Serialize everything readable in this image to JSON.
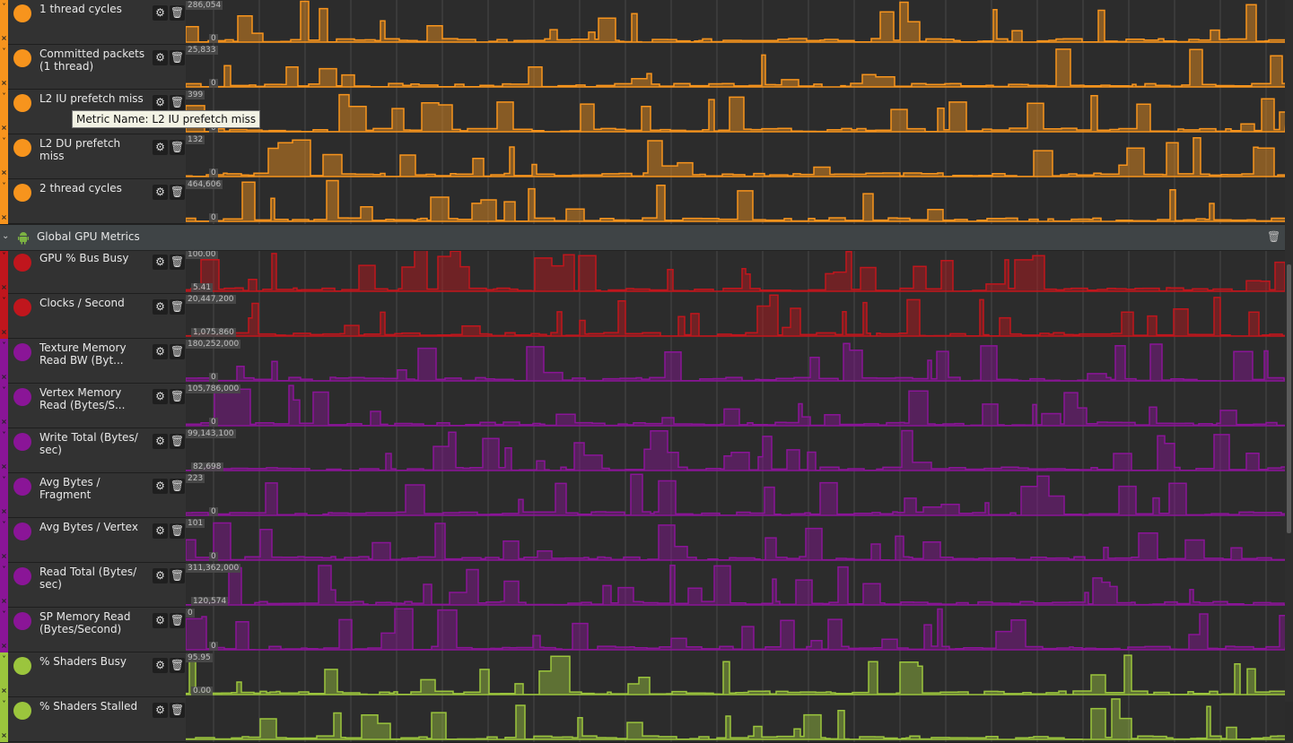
{
  "tooltip": "Metric Name: L2 IU prefetch miss",
  "global_group": {
    "title": "Global GPU Metrics",
    "icon": "android-icon"
  },
  "cpu_tracks": [
    {
      "name": "1 thread cycles",
      "max": "286,054",
      "min": "0",
      "color": "#f7941d"
    },
    {
      "name": "Committed packets (1 thread)",
      "max": "25,833",
      "min": "0",
      "color": "#f7941d"
    },
    {
      "name": "L2 IU prefetch miss",
      "max": "399",
      "min": "0",
      "color": "#f7941d"
    },
    {
      "name": "L2 DU prefetch miss",
      "max": "132",
      "min": "0",
      "color": "#f7941d"
    },
    {
      "name": "2 thread cycles",
      "max": "464,606",
      "min": "0",
      "color": "#f7941d"
    }
  ],
  "gpu_tracks": [
    {
      "name": "GPU % Bus Busy",
      "max": "100.00",
      "min": "5.41",
      "color": "#c0161d"
    },
    {
      "name": "Clocks / Second",
      "max": "20,447,200",
      "min": "1,075,860",
      "color": "#c0161d"
    },
    {
      "name": "Texture Memory Read BW (Byt...",
      "max": "180,252,000",
      "min": "0",
      "color": "#8a1597"
    },
    {
      "name": "Vertex Memory Read (Bytes/S...",
      "max": "105,786,000",
      "min": "0",
      "color": "#8a1597"
    },
    {
      "name": "Write Total (Bytes/ sec)",
      "max": "99,143,100",
      "min": "82,698",
      "color": "#8a1597"
    },
    {
      "name": "Avg Bytes / Fragment",
      "max": "223",
      "min": "0",
      "color": "#8a1597"
    },
    {
      "name": "Avg Bytes / Vertex",
      "max": "101",
      "min": "0",
      "color": "#8a1597"
    },
    {
      "name": "Read Total (Bytes/ sec)",
      "max": "311,362,000",
      "min": "120,574",
      "color": "#8a1597"
    },
    {
      "name": "SP Memory Read (Bytes/Second)",
      "max": "0",
      "min": "0",
      "color": "#8a1597"
    },
    {
      "name": "% Shaders Busy",
      "max": "95.95",
      "min": "0.00",
      "color": "#9bc53d"
    }
  ],
  "partial_track": {
    "name": "% Shaders Stalled",
    "color": "#9bc53d"
  }
}
